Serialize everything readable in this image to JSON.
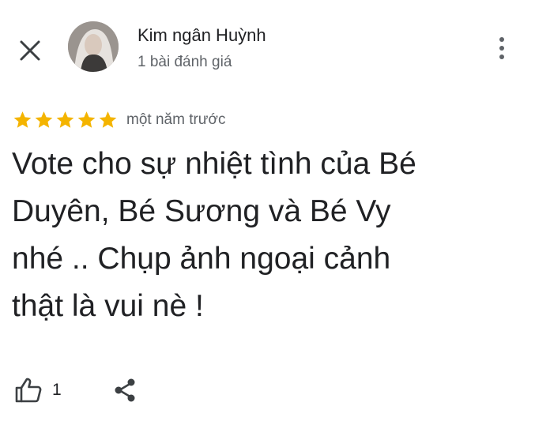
{
  "header": {
    "user_name": "Kim ngân Huỳnh",
    "user_meta": "1 bài đánh giá"
  },
  "review": {
    "rating": 5,
    "max_rating": 5,
    "time": "một năm trước",
    "text": "Vote cho sự nhiệt tình của Bé\nDuyên, Bé Sương và Bé Vy\nnhé .. Chụp ảnh ngoại cảnh\nthật là vui nè !"
  },
  "actions": {
    "like_count": "1"
  },
  "colors": {
    "star": "#f4b400",
    "text": "#202124",
    "secondary": "#5f6368"
  },
  "icons": [
    "close-icon",
    "more-vert-icon",
    "star-icon",
    "thumb-up-icon",
    "share-icon"
  ]
}
